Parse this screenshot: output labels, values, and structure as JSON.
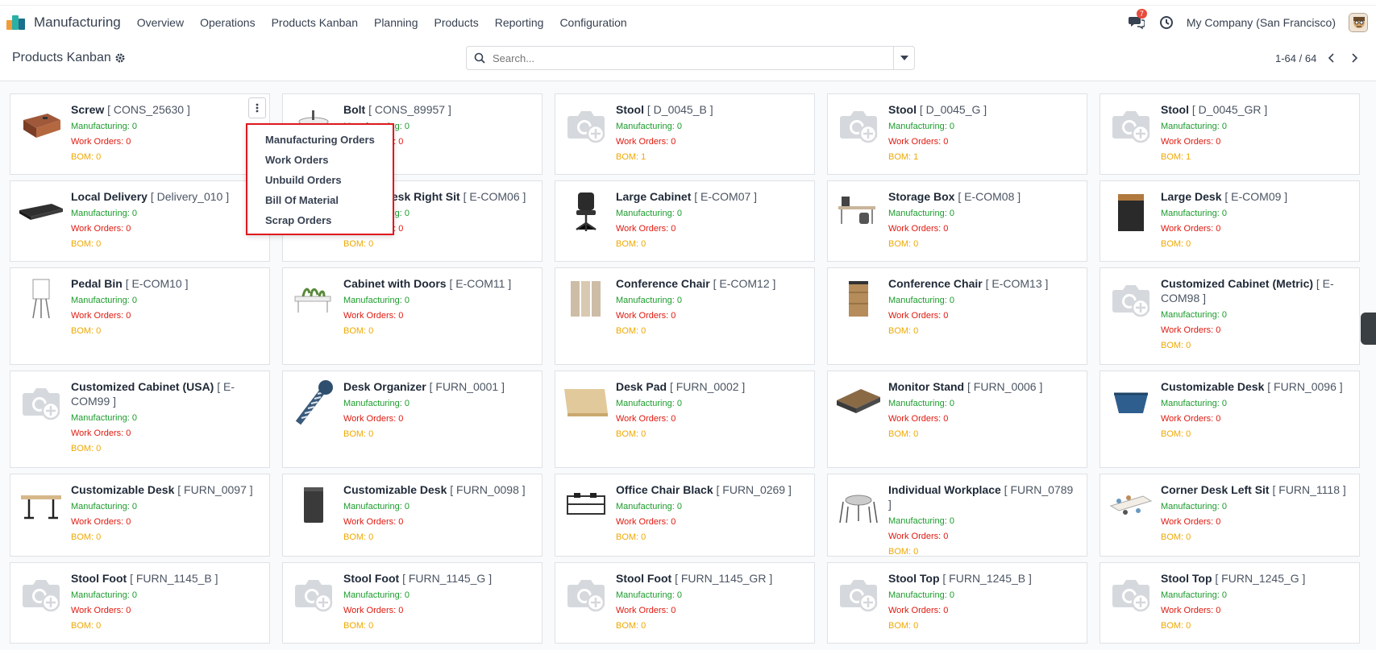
{
  "navbar": {
    "app_name": "Manufacturing",
    "menu": [
      "Overview",
      "Operations",
      "Products Kanban",
      "Planning",
      "Products",
      "Reporting",
      "Configuration"
    ],
    "message_badge": "7",
    "company": "My Company (San Francisco)"
  },
  "control_panel": {
    "breadcrumb": "Products Kanban",
    "search_placeholder": "Search...",
    "pager": "1-64 / 64"
  },
  "labels": {
    "mo": "Manufacturing: ",
    "wo": "Work Orders: ",
    "bom": "BOM: "
  },
  "dropdown": [
    "Manufacturing Orders",
    "Work Orders",
    "Unbuild Orders",
    "Bill Of Material",
    "Scrap Orders"
  ],
  "products": [
    {
      "name": "Screw",
      "code": "[ CONS_25630 ]",
      "mo": "0",
      "wo": "0",
      "bom": "0",
      "img": "box"
    },
    {
      "name": "Bolt",
      "code": "[ CONS_89957 ]",
      "mo": "0",
      "wo": "0",
      "bom": "0",
      "img": "sink"
    },
    {
      "name": "Stool",
      "code": "[ D_0045_B ]",
      "mo": "0",
      "wo": "0",
      "bom": "1",
      "img": "placeholder"
    },
    {
      "name": "Stool",
      "code": "[ D_0045_G ]",
      "mo": "0",
      "wo": "0",
      "bom": "1",
      "img": "placeholder"
    },
    {
      "name": "Stool",
      "code": "[ D_0045_GR ]",
      "mo": "0",
      "wo": "0",
      "bom": "1",
      "img": "placeholder"
    },
    {
      "name": "Local Delivery",
      "code": "[ Delivery_010 ]",
      "mo": "0",
      "wo": "0",
      "bom": "0",
      "img": "board"
    },
    {
      "name": "Corner Desk Right Sit",
      "code": "[ E-COM06 ]",
      "mo": "0",
      "wo": "0",
      "bom": "0",
      "img": "none"
    },
    {
      "name": "Large Cabinet",
      "code": "[ E-COM07 ]",
      "mo": "0",
      "wo": "0",
      "bom": "0",
      "img": "chair"
    },
    {
      "name": "Storage Box",
      "code": "[ E-COM08 ]",
      "mo": "0",
      "wo": "0",
      "bom": "0",
      "img": "desk"
    },
    {
      "name": "Large Desk",
      "code": "[ E-COM09 ]",
      "mo": "0",
      "wo": "0",
      "bom": "0",
      "img": "cabinet-dark"
    },
    {
      "name": "Pedal Bin",
      "code": "[ E-COM10 ]",
      "mo": "0",
      "wo": "0",
      "bom": "0",
      "img": "flipchart"
    },
    {
      "name": "Cabinet with Doors",
      "code": "[ E-COM11 ]",
      "mo": "0",
      "wo": "0",
      "bom": "0",
      "img": "planter"
    },
    {
      "name": "Conference Chair",
      "code": "[ E-COM12 ]",
      "mo": "0",
      "wo": "0",
      "bom": "0",
      "img": "screen"
    },
    {
      "name": "Conference Chair",
      "code": "[ E-COM13 ]",
      "mo": "0",
      "wo": "0",
      "bom": "0",
      "img": "drawers"
    },
    {
      "name": "Customized Cabinet (Metric)",
      "code": "[ E-COM98 ]",
      "mo": "0",
      "wo": "0",
      "bom": "0",
      "img": "placeholder"
    },
    {
      "name": "Customized Cabinet (USA)",
      "code": "[ E-COM99 ]",
      "mo": "0",
      "wo": "0",
      "bom": "0",
      "img": "placeholder"
    },
    {
      "name": "Desk Organizer",
      "code": "[ FURN_0001 ]",
      "mo": "0",
      "wo": "0",
      "bom": "0",
      "img": "screw"
    },
    {
      "name": "Desk Pad",
      "code": "[ FURN_0002 ]",
      "mo": "0",
      "wo": "0",
      "bom": "0",
      "img": "plywood"
    },
    {
      "name": "Monitor Stand",
      "code": "[ FURN_0006 ]",
      "mo": "0",
      "wo": "0",
      "bom": "0",
      "img": "woodboard"
    },
    {
      "name": "Customizable Desk",
      "code": "[ FURN_0096 ]",
      "mo": "0",
      "wo": "0",
      "bom": "0",
      "img": "basket"
    },
    {
      "name": "Customizable Desk",
      "code": "[ FURN_0097 ]",
      "mo": "0",
      "wo": "0",
      "bom": "0",
      "img": "deskframe"
    },
    {
      "name": "Customizable Desk",
      "code": "[ FURN_0098 ]",
      "mo": "0",
      "wo": "0",
      "bom": "0",
      "img": "bin"
    },
    {
      "name": "Office Chair Black",
      "code": "[ FURN_0269 ]",
      "mo": "0",
      "wo": "0",
      "bom": "0",
      "img": "workstation"
    },
    {
      "name": "Individual Workplace",
      "code": "[ FURN_0789 ]",
      "mo": "0",
      "wo": "0",
      "bom": "0",
      "img": "table"
    },
    {
      "name": "Corner Desk Left Sit",
      "code": "[ FURN_1118 ]",
      "mo": "0",
      "wo": "0",
      "bom": "0",
      "img": "meeting"
    },
    {
      "name": "Stool Foot",
      "code": "[ FURN_1145_B ]",
      "mo": "0",
      "wo": "0",
      "bom": "0",
      "img": "placeholder"
    },
    {
      "name": "Stool Foot",
      "code": "[ FURN_1145_G ]",
      "mo": "0",
      "wo": "0",
      "bom": "0",
      "img": "placeholder"
    },
    {
      "name": "Stool Foot",
      "code": "[ FURN_1145_GR ]",
      "mo": "0",
      "wo": "0",
      "bom": "0",
      "img": "placeholder"
    },
    {
      "name": "Stool Top",
      "code": "[ FURN_1245_B ]",
      "mo": "0",
      "wo": "0",
      "bom": "0",
      "img": "placeholder"
    },
    {
      "name": "Stool Top",
      "code": "[ FURN_1245_G ]",
      "mo": "0",
      "wo": "0",
      "bom": "0",
      "img": "placeholder"
    }
  ]
}
